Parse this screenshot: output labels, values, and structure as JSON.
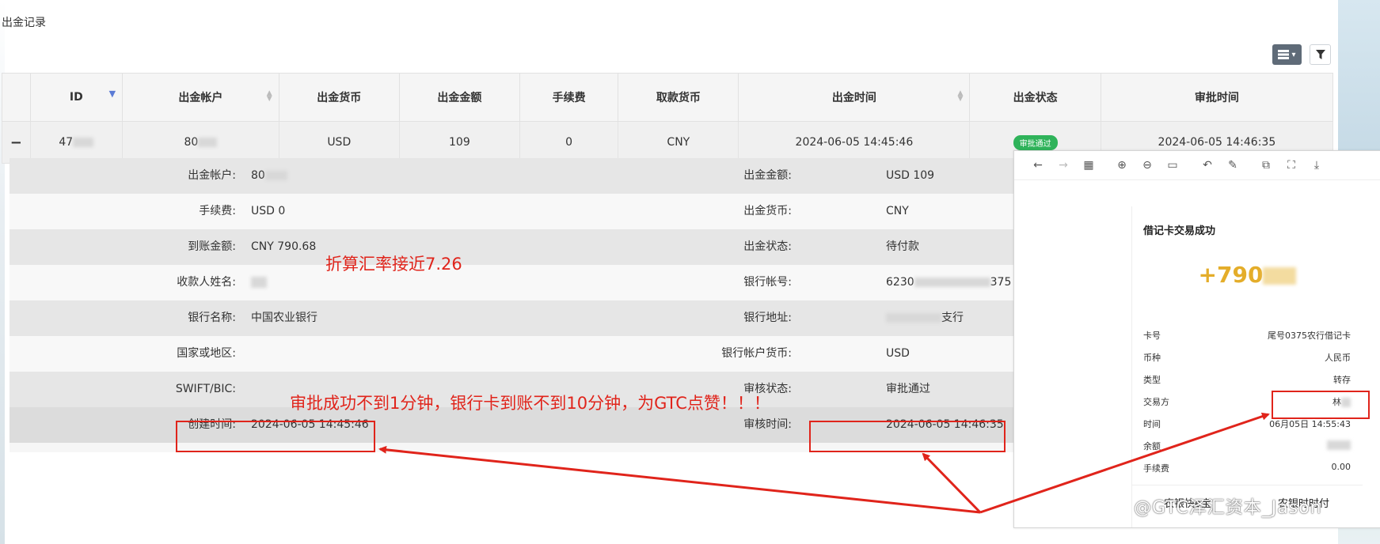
{
  "page": {
    "title": "出金记录"
  },
  "toolbar": {
    "list_caret": "▾",
    "list_icon": "list-icon",
    "filter_icon": "filter-icon"
  },
  "table": {
    "headers": [
      "",
      "ID",
      "出金帐户",
      "出金货币",
      "出金金额",
      "手续费",
      "取款货币",
      "出金时间",
      "出金状态",
      "审批时间"
    ],
    "row": {
      "toggle": "−",
      "id": "47",
      "account": "80",
      "currency": "USD",
      "amount": "109",
      "fee": "0",
      "withdraw_currency": "CNY",
      "time": "2024-06-05 14:45:46",
      "status": "审批通过",
      "approve_time": "2024-06-05 14:46:35"
    }
  },
  "detail": {
    "rows": [
      {
        "l_label": "出金帐户:",
        "l_value": "80",
        "r_label": "出金金额:",
        "r_value": "USD 109"
      },
      {
        "l_label": "手续费:",
        "l_value": "USD 0",
        "r_label": "出金货币:",
        "r_value": "CNY"
      },
      {
        "l_label": "到账金额:",
        "l_value": "CNY 790.68",
        "r_label": "出金状态:",
        "r_value": "待付款"
      },
      {
        "l_label": "收款人姓名:",
        "l_value": "",
        "r_label": "银行帐号:",
        "r_value": "6230",
        "r_value_tail": "375"
      },
      {
        "l_label": "银行名称:",
        "l_value": "中国农业银行",
        "r_label": "银行地址:",
        "r_value": "支行"
      },
      {
        "l_label": "国家或地区:",
        "l_value": "",
        "r_label": "银行帐户货币:",
        "r_value": "USD"
      },
      {
        "l_label": "SWIFT/BIC:",
        "l_value": "",
        "r_label": "审核状态:",
        "r_value": "审批通过"
      },
      {
        "l_label": "创建时间:",
        "l_value": "2024-06-05 14:45:46",
        "r_label": "审核时间:",
        "r_value": "2024-06-05 14:46:35"
      }
    ]
  },
  "annotations": {
    "rate": "折算汇率接近7.26",
    "praise": "审批成功不到1分钟，银行卡到账不到10分钟，为GTC点赞！！！"
  },
  "receipt": {
    "title": "借记卡交易成功",
    "amount": "+790",
    "rows": [
      {
        "k": "卡号",
        "v": "尾号0375农行借记卡"
      },
      {
        "k": "币种",
        "v": "人民币"
      },
      {
        "k": "类型",
        "v": "转存"
      },
      {
        "k": "交易方",
        "v": "林"
      },
      {
        "k": "时间",
        "v": "06月05日 14:55:43"
      },
      {
        "k": "余额",
        "v": ""
      },
      {
        "k": "手续费",
        "v": "0.00"
      }
    ],
    "footer_left": "农银快e宝",
    "footer_right": "农银时时付"
  },
  "watermark": "@GTC泽汇资本_Jason",
  "colors": {
    "annotation_red": "#e0241b",
    "status_green": "#2fb35a",
    "amount_gold": "#e4ad2a",
    "toolbar_gray": "#5f6b78"
  }
}
